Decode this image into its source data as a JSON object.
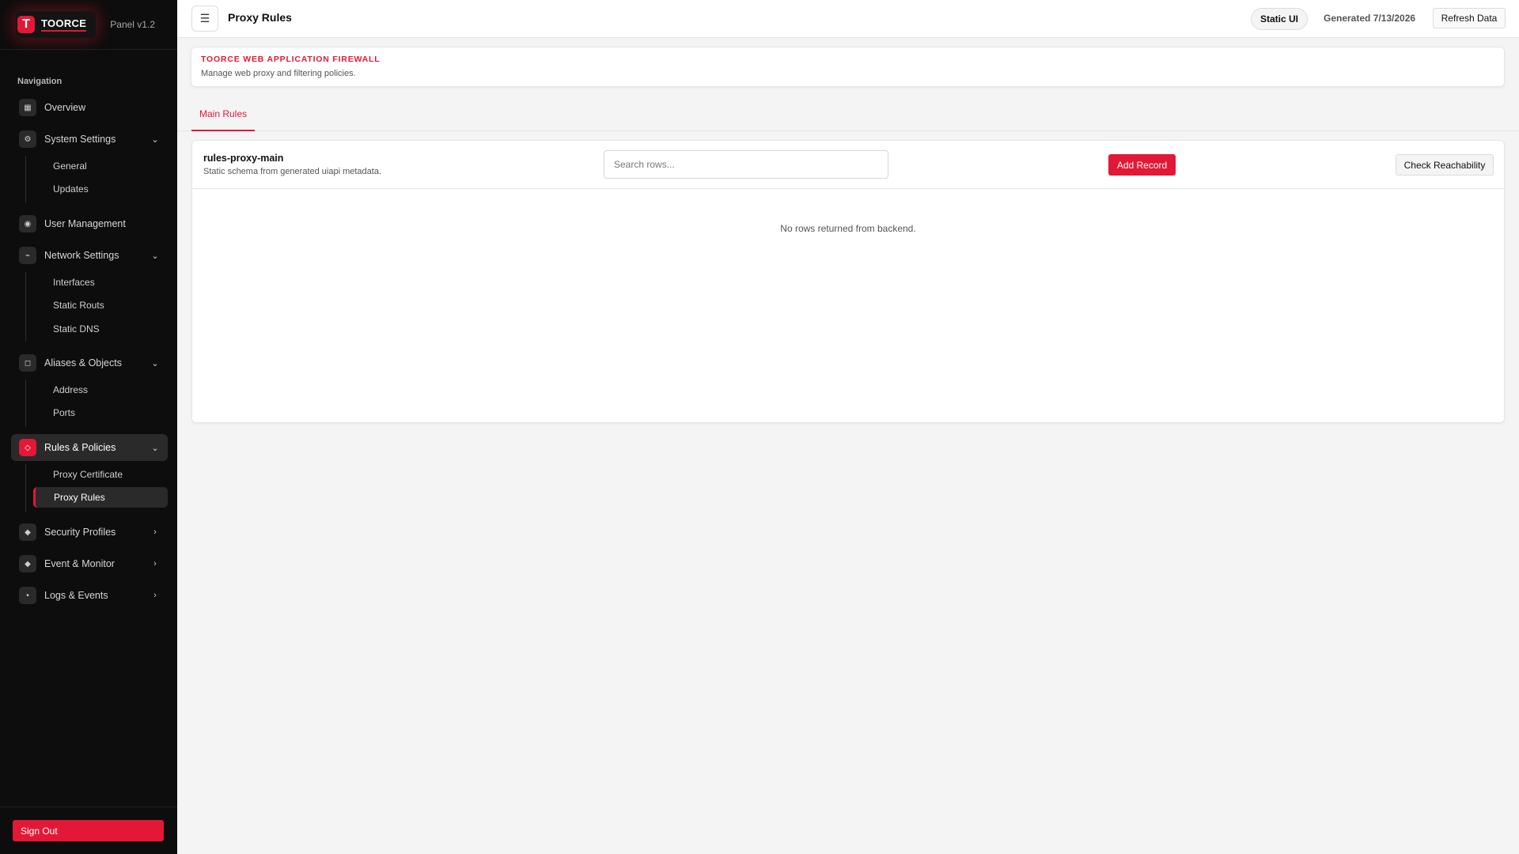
{
  "brand": {
    "logo_letter": "T",
    "name": "TOORCE",
    "version": "Panel v1.2"
  },
  "nav": {
    "heading": "Navigation",
    "items": [
      {
        "label": "Overview",
        "icon": "▦",
        "chev": ""
      },
      {
        "label": "System Settings",
        "icon": "⚙",
        "chev": "⌄",
        "children": [
          "General",
          "Updates"
        ]
      },
      {
        "label": "User Management",
        "icon": "◉",
        "chev": ""
      },
      {
        "label": "Network Settings",
        "icon": "⌁",
        "chev": "⌄",
        "children": [
          "Interfaces",
          "Static Routs",
          "Static DNS"
        ]
      },
      {
        "label": "Aliases & Objects",
        "icon": "◻",
        "chev": "⌄",
        "children": [
          "Address",
          "Ports"
        ]
      },
      {
        "label": "Rules & Policies",
        "icon": "◇",
        "chev": "⌄",
        "children": [
          "Proxy Certificate",
          "Proxy Rules"
        ]
      },
      {
        "label": "Security Profiles",
        "icon": "◆",
        "chev": "›"
      },
      {
        "label": "Event & Monitor",
        "icon": "◆",
        "chev": "›"
      },
      {
        "label": "Logs & Events",
        "icon": "•",
        "chev": "›"
      }
    ],
    "active_item": "Rules & Policies",
    "active_sub": "Proxy Rules"
  },
  "sign_out": "Sign Out",
  "topbar": {
    "menu_icon": "☰",
    "title": "Proxy Rules",
    "static_pill": "Static UI",
    "generated": "Generated 7/13/2026",
    "refresh": "Refresh Data"
  },
  "header": {
    "eyebrow": "TOORCE WEB APPLICATION FIREWALL",
    "subtitle": "Manage web proxy and filtering policies."
  },
  "tabs": [
    {
      "label": "Main Rules",
      "active": true
    }
  ],
  "table": {
    "name": "rules-proxy-main",
    "description": "Static schema from generated uiapi metadata.",
    "search_placeholder": "Search rows...",
    "add_button": "Add Record",
    "check_button": "Check Reachability",
    "empty_message": "No rows returned from backend."
  },
  "colors": {
    "accent": "#e31837",
    "sidebar_bg": "#0d0d0d",
    "page_bg": "#f4f4f4"
  }
}
